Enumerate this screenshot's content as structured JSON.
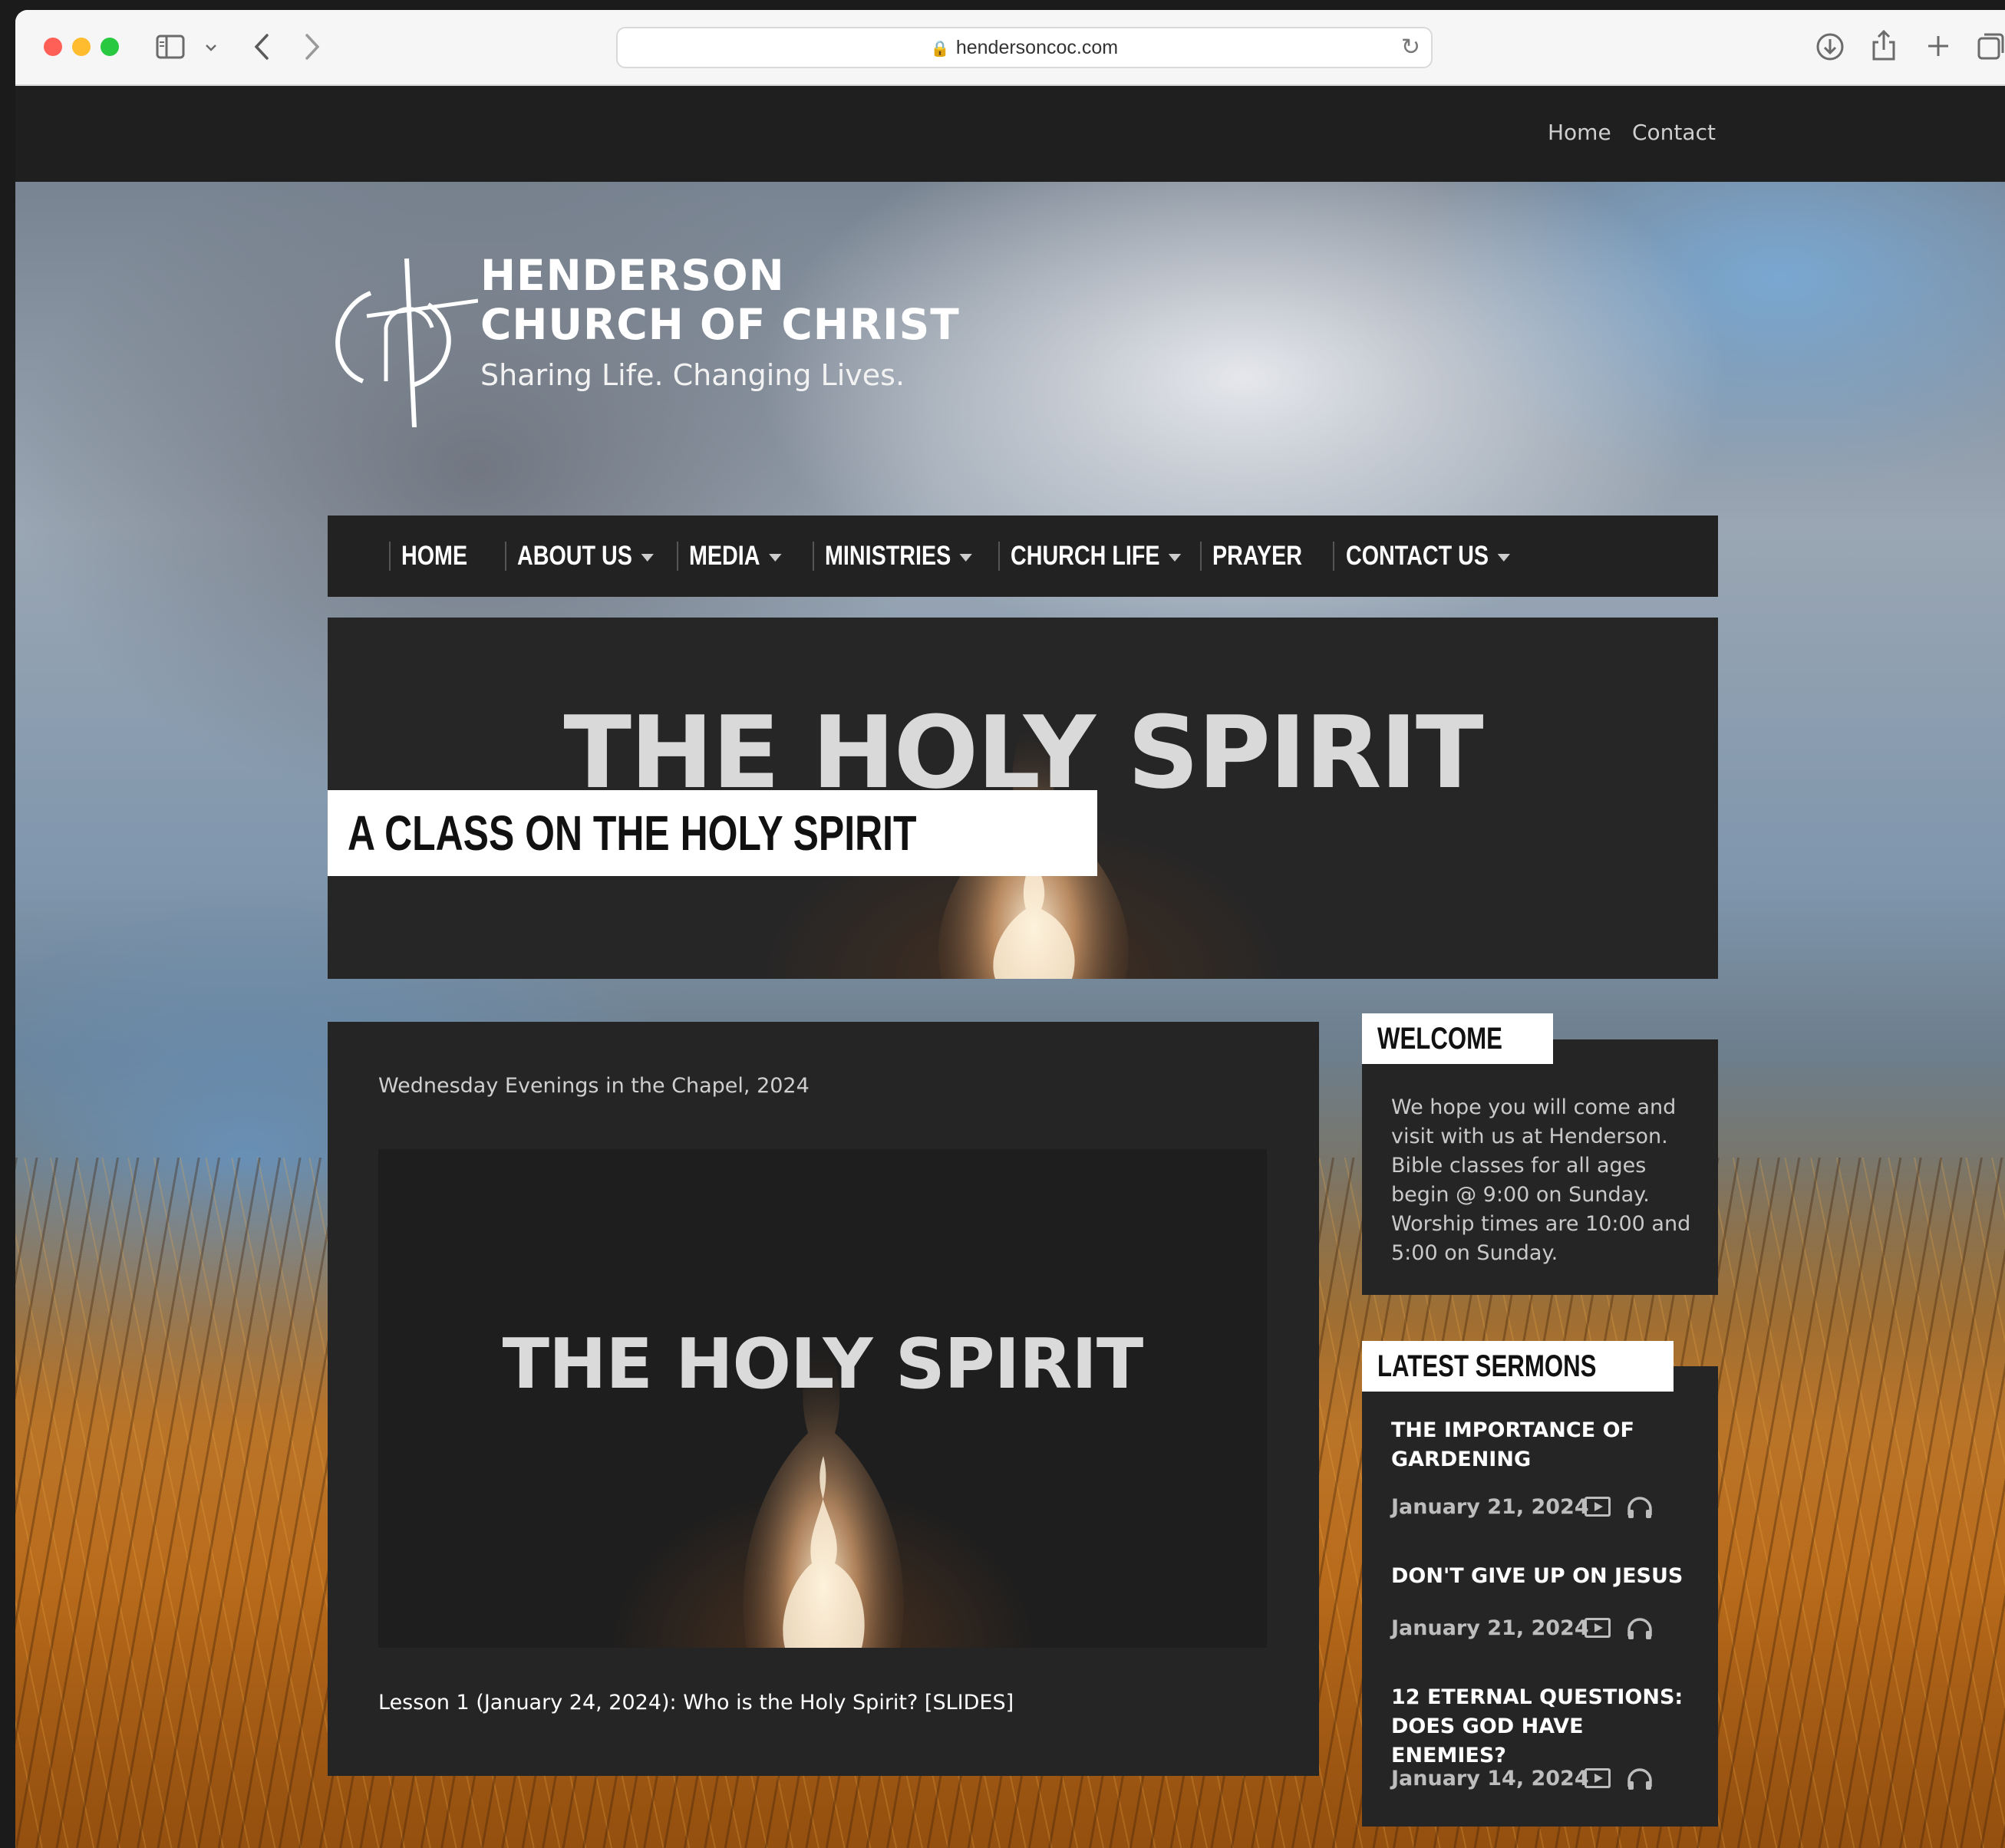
{
  "browser": {
    "url": "hendersoncoc.com",
    "icons": [
      "sidebar-icon",
      "chevron-down-icon",
      "back-icon",
      "forward-icon",
      "lock-icon",
      "reload-icon",
      "download-icon",
      "share-icon",
      "new-tab-icon",
      "tabs-icon"
    ]
  },
  "topbar": {
    "links": [
      "Home",
      "Contact"
    ]
  },
  "logo": {
    "line1": "HENDERSON",
    "line2": "CHURCH OF CHRIST",
    "tagline": "Sharing Life. Changing Lives."
  },
  "nav": {
    "items": [
      {
        "label": "HOME",
        "dropdown": false
      },
      {
        "label": "ABOUT US",
        "dropdown": true
      },
      {
        "label": "MEDIA",
        "dropdown": true
      },
      {
        "label": "MINISTRIES",
        "dropdown": true
      },
      {
        "label": "CHURCH LIFE",
        "dropdown": true
      },
      {
        "label": "PRAYER",
        "dropdown": false
      },
      {
        "label": "CONTACT US",
        "dropdown": true
      }
    ]
  },
  "hero": {
    "title": "THE HOLY SPIRIT",
    "label": "A CLASS ON THE HOLY SPIRIT"
  },
  "content": {
    "subtitle": "Wednesday Evenings in the Chapel, 2024",
    "image_title": "THE HOLY SPIRIT",
    "lesson_link": "Lesson 1 (January 24, 2024): Who is the Holy Spirit? [SLIDES]"
  },
  "sidebar": {
    "welcome": {
      "label": "WELCOME",
      "text": "We hope you will come and visit with us at Henderson. Bible classes for all ages begin @ 9:00 on Sunday. Worship times are 10:00 and 5:00 on Sunday."
    },
    "sermons": {
      "label": "LATEST SERMONS",
      "items": [
        {
          "title": "THE IMPORTANCE OF GARDENING",
          "date": "January 21, 2024"
        },
        {
          "title": "DON'T GIVE UP ON JESUS",
          "date": "January 21, 2024"
        },
        {
          "title": "12 ETERNAL QUESTIONS: DOES GOD HAVE ENEMIES?",
          "date": "January 14, 2024"
        }
      ]
    }
  },
  "colors": {
    "nav_bg": "#222222",
    "panel_bg": "#252525",
    "label_bg": "#ffffff"
  }
}
